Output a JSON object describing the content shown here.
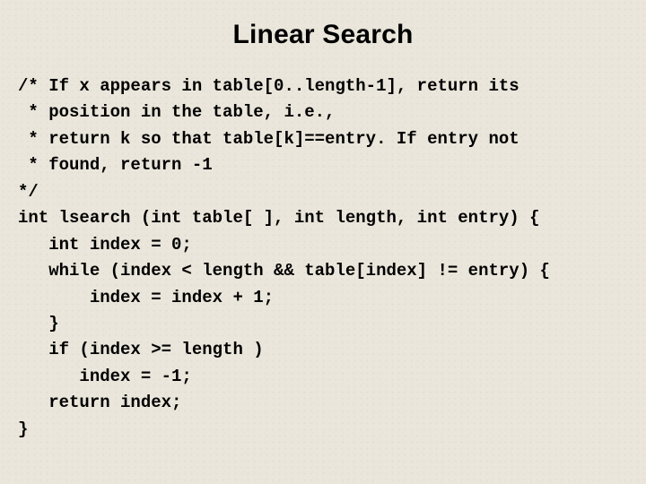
{
  "title": "Linear Search",
  "code_lines": [
    "/* If x appears in table[0..length-1], return its",
    " * position in the table, i.e.,",
    " * return k so that table[k]==entry. If entry not",
    " * found, return -1",
    "*/",
    "int lsearch (int table[ ], int length, int entry) {",
    "   int index = 0;",
    "   while (index < length && table[index] != entry) {",
    "       index = index + 1;",
    "   }",
    "   if (index >= length )",
    "      index = -1;",
    "   return index;",
    "}"
  ]
}
